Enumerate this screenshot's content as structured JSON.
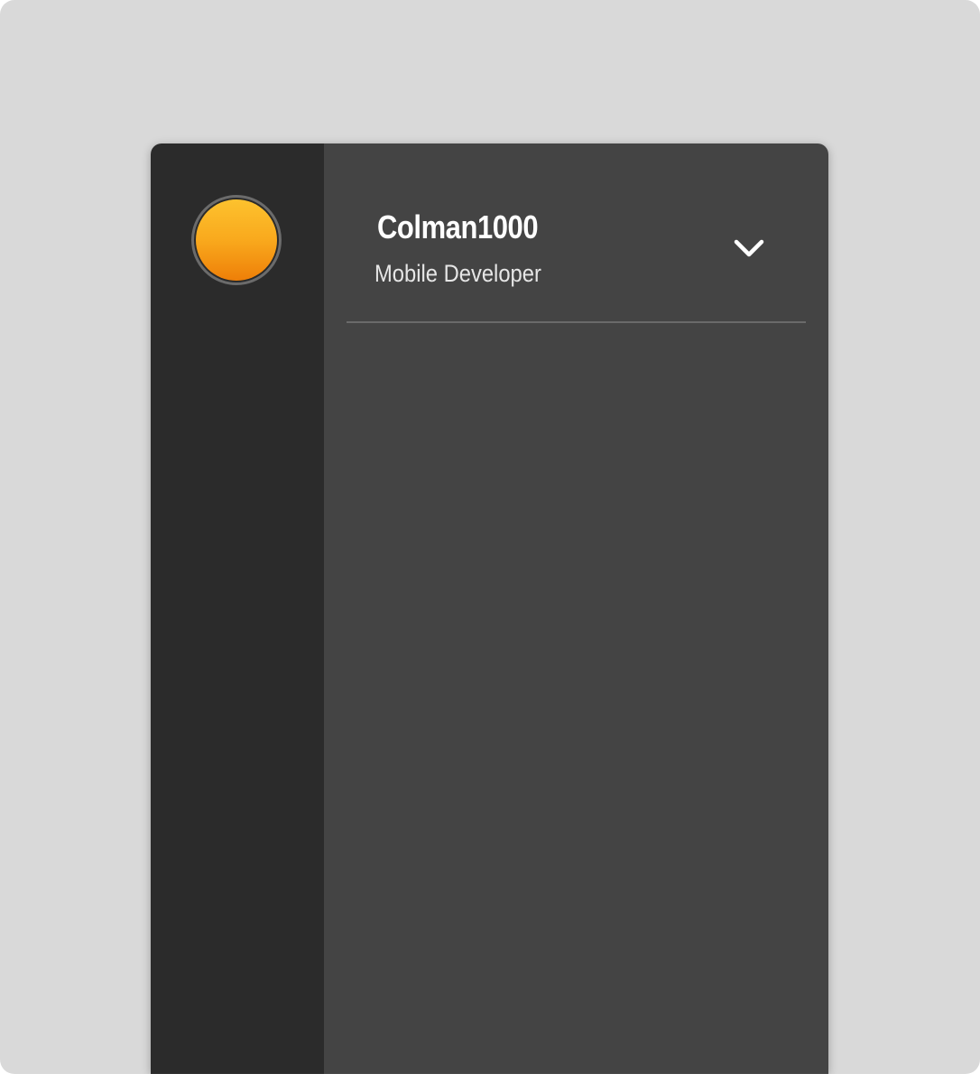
{
  "account": {
    "username": "Colman1000",
    "role": "Mobile Developer"
  },
  "icons": {
    "avatar": "avatar-icon",
    "toggle": "chevron-down-icon"
  },
  "colors": {
    "background": "#d9d9d9",
    "rail": "#2b2b2b",
    "panel": "#444444",
    "avatar_top": "#fdc22e",
    "avatar_bottom": "#ee7f08",
    "text_primary": "#ffffff",
    "text_secondary": "#e6e6e6",
    "divider": "#6a6a6a"
  }
}
